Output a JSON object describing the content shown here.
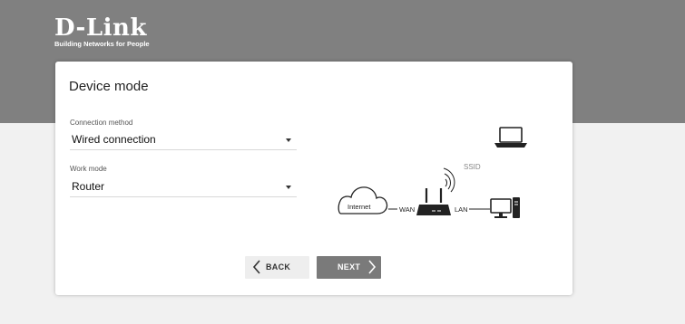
{
  "brand": {
    "name": "D-Link",
    "tagline": "Building Networks for People"
  },
  "card": {
    "title": "Device mode"
  },
  "connection_method": {
    "label": "Connection method",
    "value": "Wired connection"
  },
  "work_mode": {
    "label": "Work mode",
    "value": "Router"
  },
  "diagram": {
    "internet_label": "Internet",
    "wan_label": "WAN",
    "lan_label": "LAN",
    "ssid_label": "SSID"
  },
  "buttons": {
    "back": "BACK",
    "next": "NEXT"
  },
  "icons": [
    "chevron-down-icon",
    "cloud-icon",
    "router-icon",
    "wifi-signal-icon",
    "laptop-icon",
    "desktop-computer-icon",
    "chevron-left-icon",
    "chevron-right-icon"
  ],
  "colors": {
    "header_band": "#808080",
    "page_background": "#f1f1f1",
    "card_background": "#ffffff",
    "back_button": "#eeeeee",
    "next_button": "#7a7a7a"
  }
}
